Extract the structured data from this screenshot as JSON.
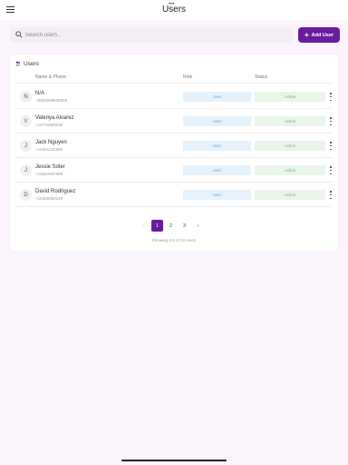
{
  "header": {
    "title": "Users",
    "status_dots": "•••"
  },
  "search": {
    "placeholder": "Search users..."
  },
  "toolbar": {
    "add_label": "Add User",
    "add_icon": "+"
  },
  "card": {
    "title": "Users"
  },
  "table": {
    "columns": {
      "name_phone": "Name & Phone",
      "role": "Role",
      "status": "Status"
    },
    "rows": [
      {
        "initial": "N",
        "name": "N/A",
        "phone": "+6054998635985",
        "role": "User",
        "status": "Active"
      },
      {
        "initial": "V",
        "name": "Valeriya Alvarez",
        "phone": "+15718309036",
        "role": "User",
        "status": "Active"
      },
      {
        "initial": "J",
        "name": "Jack  Nguyen",
        "phone": "+15551231885",
        "role": "User",
        "status": "Active"
      },
      {
        "initial": "J",
        "name": "Jessie  Soler",
        "phone": "+15554987899",
        "role": "User",
        "status": "Active"
      },
      {
        "initial": "D",
        "name": "David Rodriguez",
        "phone": "+16465550149",
        "role": "User",
        "status": "Active"
      }
    ]
  },
  "pagination": {
    "prev": "‹",
    "pages": [
      "1",
      "2",
      "3"
    ],
    "next": "›",
    "current": 1,
    "summary": "Showing 1-5 of 33 users"
  },
  "colors": {
    "accent": "#6a1ca0",
    "role_bg": "#e6f2fb",
    "status_bg": "#e9f5e8"
  }
}
